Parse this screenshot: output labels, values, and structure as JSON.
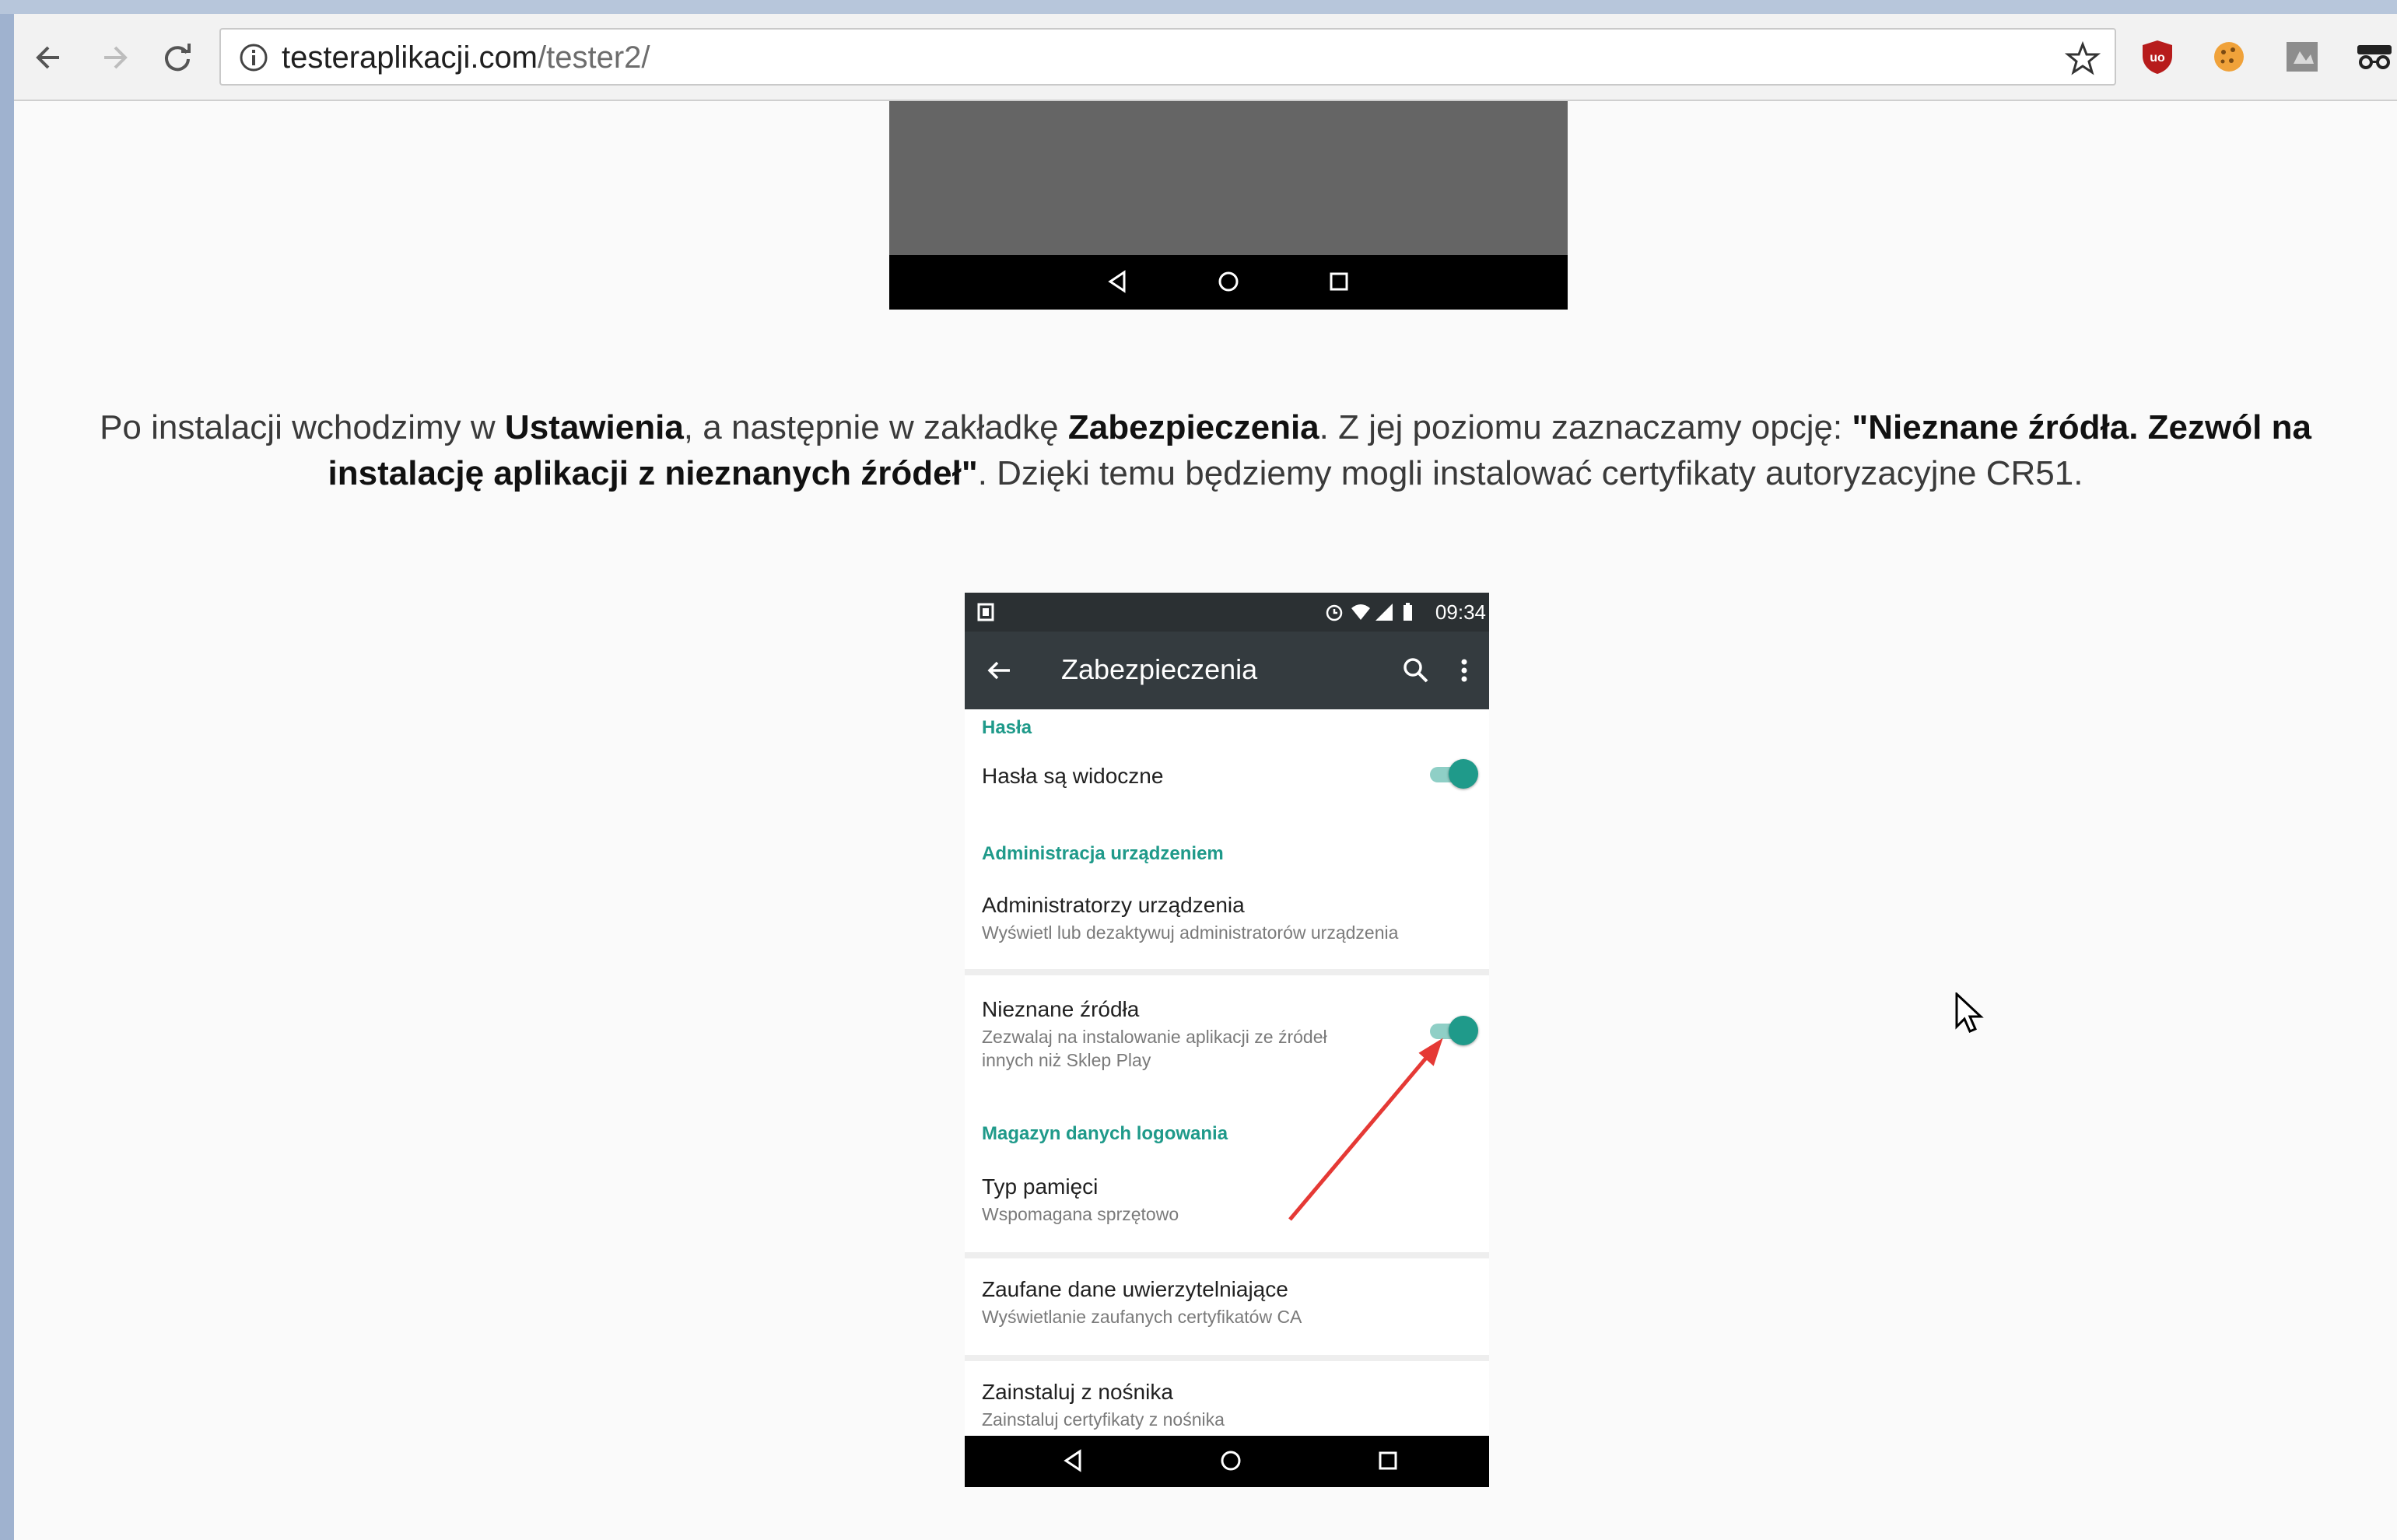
{
  "browser": {
    "url_domain": "testeraplikacji.com",
    "url_path": "/tester2/",
    "back_icon": "arrow-left-icon",
    "forward_icon": "arrow-right-icon",
    "reload_icon": "reload-icon",
    "info_icon": "info-icon",
    "bookmark_icon": "star-icon",
    "extensions": [
      "ublock-icon",
      "cookie-icon",
      "extension-icon",
      "incognito-icon"
    ]
  },
  "article": {
    "p1_a": "Po instalacji wchodzimy w ",
    "p1_b": "Ustawienia",
    "p1_c": ", a następnie w zakładkę ",
    "p1_d": "Zabezpieczenia",
    "p1_e": ". Z jej poziomu zaznaczamy opcję: ",
    "p1_f": "\"Nieznane źródła. Zezwól na instalację aplikacji z nieznanych źródeł\"",
    "p1_g": ". Dzięki temu będziemy mogli instalować certyfikaty autoryzacyjne CR51."
  },
  "phone": {
    "status_time": "09:34",
    "appbar_title": "Zabezpieczenia",
    "sections": {
      "passwords_header": "Hasła",
      "passwords_visible": "Hasła są widoczne",
      "admin_header": "Administracja urządzeniem",
      "admins_title": "Administratorzy urządzenia",
      "admins_sub": "Wyświetl lub dezaktywuj administratorów urządzenia",
      "unknown_title": "Nieznane źródła",
      "unknown_sub_1": "Zezwalaj na instalowanie aplikacji ze źródeł",
      "unknown_sub_2": "innych niż Sklep Play",
      "storage_header": "Magazyn danych logowania",
      "storage_type_title": "Typ pamięci",
      "storage_type_sub": "Wspomagana sprzętowo",
      "trusted_title": "Zaufane dane uwierzytelniające",
      "trusted_sub": "Wyświetlanie zaufanych certyfikatów CA",
      "install_title": "Zainstaluj z nośnika",
      "install_sub": "Zainstaluj certyfikaty z nośnika"
    },
    "toggles": {
      "passwords_visible": true,
      "unknown_sources": true
    },
    "accent_color": "#1f9a8a",
    "arrow_color": "#e53935"
  }
}
